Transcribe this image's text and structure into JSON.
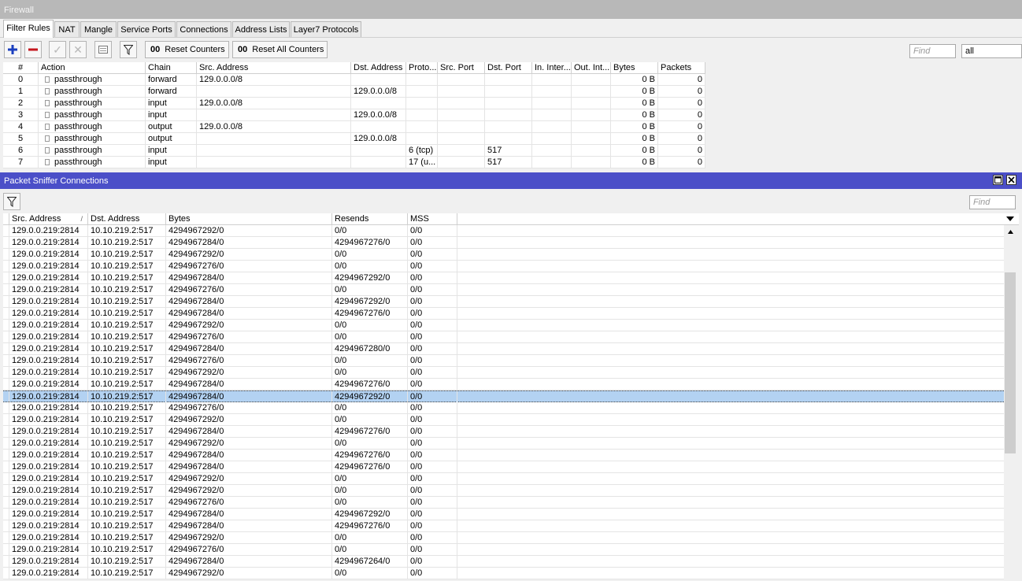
{
  "firewall": {
    "title": "Firewall",
    "tabs": [
      "Filter Rules",
      "NAT",
      "Mangle",
      "Service Ports",
      "Connections",
      "Address Lists",
      "Layer7 Protocols"
    ],
    "toolbar": {
      "add_icon": "plus-icon",
      "remove_icon": "minus-icon",
      "enable_icon": "check-icon",
      "disable_icon": "x-icon",
      "comment_icon": "note-icon",
      "filter_icon": "funnel-icon",
      "reset_counters": "Reset Counters",
      "reset_all_counters": "Reset All Counters",
      "counter_prefix": "00",
      "find_placeholder": "Find",
      "filter_value": "all"
    },
    "columns": [
      "#",
      "Action",
      "Chain",
      "Src. Address",
      "Dst. Address",
      "Proto...",
      "Src. Port",
      "Dst. Port",
      "In. Inter...",
      "Out. Int...",
      "Bytes",
      "Packets"
    ],
    "rules": [
      {
        "num": "0",
        "action": "passthrough",
        "chain": "forward",
        "src": "129.0.0.0/8",
        "dst": "",
        "proto": "",
        "sport": "",
        "dport": "",
        "inif": "",
        "outif": "",
        "bytes": "0 B",
        "packets": "0"
      },
      {
        "num": "1",
        "action": "passthrough",
        "chain": "forward",
        "src": "",
        "dst": "129.0.0.0/8",
        "proto": "",
        "sport": "",
        "dport": "",
        "inif": "",
        "outif": "",
        "bytes": "0 B",
        "packets": "0"
      },
      {
        "num": "2",
        "action": "passthrough",
        "chain": "input",
        "src": "129.0.0.0/8",
        "dst": "",
        "proto": "",
        "sport": "",
        "dport": "",
        "inif": "",
        "outif": "",
        "bytes": "0 B",
        "packets": "0"
      },
      {
        "num": "3",
        "action": "passthrough",
        "chain": "input",
        "src": "",
        "dst": "129.0.0.0/8",
        "proto": "",
        "sport": "",
        "dport": "",
        "inif": "",
        "outif": "",
        "bytes": "0 B",
        "packets": "0"
      },
      {
        "num": "4",
        "action": "passthrough",
        "chain": "output",
        "src": "129.0.0.0/8",
        "dst": "",
        "proto": "",
        "sport": "",
        "dport": "",
        "inif": "",
        "outif": "",
        "bytes": "0 B",
        "packets": "0"
      },
      {
        "num": "5",
        "action": "passthrough",
        "chain": "output",
        "src": "",
        "dst": "129.0.0.0/8",
        "proto": "",
        "sport": "",
        "dport": "",
        "inif": "",
        "outif": "",
        "bytes": "0 B",
        "packets": "0"
      },
      {
        "num": "6",
        "action": "passthrough",
        "chain": "input",
        "src": "",
        "dst": "",
        "proto": "6 (tcp)",
        "sport": "",
        "dport": "517",
        "inif": "",
        "outif": "",
        "bytes": "0 B",
        "packets": "0"
      },
      {
        "num": "7",
        "action": "passthrough",
        "chain": "input",
        "src": "",
        "dst": "",
        "proto": "17 (u...",
        "sport": "",
        "dport": "517",
        "inif": "",
        "outif": "",
        "bytes": "0 B",
        "packets": "0"
      }
    ]
  },
  "sniffer": {
    "title": "Packet Sniffer Connections",
    "restore_icon": "restore-icon",
    "close_icon": "close-icon",
    "filter_icon": "funnel-icon",
    "find_placeholder": "Find",
    "columns": [
      "Src. Address",
      "Dst. Address",
      "Bytes",
      "Resends",
      "MSS"
    ],
    "sort_indicator": "/",
    "selected_index": 14,
    "rows": [
      [
        "129.0.0.219:2814",
        "10.10.219.2:517",
        "4294967292/0",
        "0/0",
        "0/0"
      ],
      [
        "129.0.0.219:2814",
        "10.10.219.2:517",
        "4294967284/0",
        "4294967276/0",
        "0/0"
      ],
      [
        "129.0.0.219:2814",
        "10.10.219.2:517",
        "4294967292/0",
        "0/0",
        "0/0"
      ],
      [
        "129.0.0.219:2814",
        "10.10.219.2:517",
        "4294967276/0",
        "0/0",
        "0/0"
      ],
      [
        "129.0.0.219:2814",
        "10.10.219.2:517",
        "4294967284/0",
        "4294967292/0",
        "0/0"
      ],
      [
        "129.0.0.219:2814",
        "10.10.219.2:517",
        "4294967276/0",
        "0/0",
        "0/0"
      ],
      [
        "129.0.0.219:2814",
        "10.10.219.2:517",
        "4294967284/0",
        "4294967292/0",
        "0/0"
      ],
      [
        "129.0.0.219:2814",
        "10.10.219.2:517",
        "4294967284/0",
        "4294967276/0",
        "0/0"
      ],
      [
        "129.0.0.219:2814",
        "10.10.219.2:517",
        "4294967292/0",
        "0/0",
        "0/0"
      ],
      [
        "129.0.0.219:2814",
        "10.10.219.2:517",
        "4294967276/0",
        "0/0",
        "0/0"
      ],
      [
        "129.0.0.219:2814",
        "10.10.219.2:517",
        "4294967284/0",
        "4294967280/0",
        "0/0"
      ],
      [
        "129.0.0.219:2814",
        "10.10.219.2:517",
        "4294967276/0",
        "0/0",
        "0/0"
      ],
      [
        "129.0.0.219:2814",
        "10.10.219.2:517",
        "4294967292/0",
        "0/0",
        "0/0"
      ],
      [
        "129.0.0.219:2814",
        "10.10.219.2:517",
        "4294967284/0",
        "4294967276/0",
        "0/0"
      ],
      [
        "129.0.0.219:2814",
        "10.10.219.2:517",
        "4294967284/0",
        "4294967292/0",
        "0/0"
      ],
      [
        "129.0.0.219:2814",
        "10.10.219.2:517",
        "4294967276/0",
        "0/0",
        "0/0"
      ],
      [
        "129.0.0.219:2814",
        "10.10.219.2:517",
        "4294967292/0",
        "0/0",
        "0/0"
      ],
      [
        "129.0.0.219:2814",
        "10.10.219.2:517",
        "4294967284/0",
        "4294967276/0",
        "0/0"
      ],
      [
        "129.0.0.219:2814",
        "10.10.219.2:517",
        "4294967292/0",
        "0/0",
        "0/0"
      ],
      [
        "129.0.0.219:2814",
        "10.10.219.2:517",
        "4294967284/0",
        "4294967276/0",
        "0/0"
      ],
      [
        "129.0.0.219:2814",
        "10.10.219.2:517",
        "4294967284/0",
        "4294967276/0",
        "0/0"
      ],
      [
        "129.0.0.219:2814",
        "10.10.219.2:517",
        "4294967292/0",
        "0/0",
        "0/0"
      ],
      [
        "129.0.0.219:2814",
        "10.10.219.2:517",
        "4294967292/0",
        "0/0",
        "0/0"
      ],
      [
        "129.0.0.219:2814",
        "10.10.219.2:517",
        "4294967276/0",
        "0/0",
        "0/0"
      ],
      [
        "129.0.0.219:2814",
        "10.10.219.2:517",
        "4294967284/0",
        "4294967292/0",
        "0/0"
      ],
      [
        "129.0.0.219:2814",
        "10.10.219.2:517",
        "4294967284/0",
        "4294967276/0",
        "0/0"
      ],
      [
        "129.0.0.219:2814",
        "10.10.219.2:517",
        "4294967292/0",
        "0/0",
        "0/0"
      ],
      [
        "129.0.0.219:2814",
        "10.10.219.2:517",
        "4294967276/0",
        "0/0",
        "0/0"
      ],
      [
        "129.0.0.219:2814",
        "10.10.219.2:517",
        "4294967284/0",
        "4294967264/0",
        "0/0"
      ],
      [
        "129.0.0.219:2814",
        "10.10.219.2:517",
        "4294967292/0",
        "0/0",
        "0/0"
      ]
    ]
  }
}
